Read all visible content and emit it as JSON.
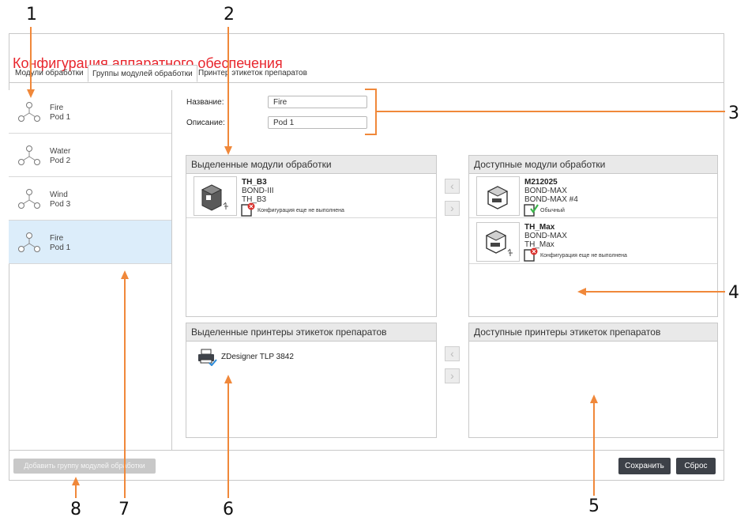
{
  "window": {
    "title": "Конфигурация аппаратного обеспечения"
  },
  "tabs": [
    {
      "label": "Модули обработки"
    },
    {
      "label": "Группы модулей обработки"
    },
    {
      "label": "Принтер этикеток препаратов"
    }
  ],
  "groups": [
    {
      "name": "Fire",
      "description": "Pod 1"
    },
    {
      "name": "Water",
      "description": "Pod 2"
    },
    {
      "name": "Wind",
      "description": "Pod 3"
    },
    {
      "name": "Fire",
      "description": "Pod 1"
    }
  ],
  "form": {
    "name_label": "Название:",
    "name_value": "Fire",
    "description_label": "Описание:",
    "description_value": "Pod 1"
  },
  "selected_modules": {
    "title": "Выделенные модули обработки",
    "items": [
      {
        "name": "TH_B3",
        "type": "BOND-III",
        "alias": "TH_B3",
        "status": "Конфигурация еще не выполнена"
      }
    ]
  },
  "available_modules": {
    "title": "Доступные модули обработки",
    "items": [
      {
        "name": "M212025",
        "type": "BOND-MAX",
        "alias": "BOND-MAX #4",
        "status": "Обычный"
      },
      {
        "name": "TH_Max",
        "type": "BOND-MAX",
        "alias": "TH_Max",
        "status": "Конфигурация еще не выполнена"
      }
    ]
  },
  "selected_printers": {
    "title": "Выделенные принтеры этикеток препаратов",
    "items": [
      {
        "name": "ZDesigner TLP 3842"
      }
    ]
  },
  "available_printers": {
    "title": "Доступные принтеры этикеток препаратов",
    "items": []
  },
  "buttons": {
    "add_group": "Добавить группу модулей обработки",
    "save": "Сохранить",
    "reset": "Сброс"
  },
  "callouts": [
    "1",
    "2",
    "3",
    "4",
    "5",
    "6",
    "7",
    "8"
  ],
  "colors": {
    "title": "#e8262d",
    "callout": "#f0883a",
    "selected_group": "#dcedfa",
    "error": "#d9302c",
    "ok": "#3ab54a"
  }
}
